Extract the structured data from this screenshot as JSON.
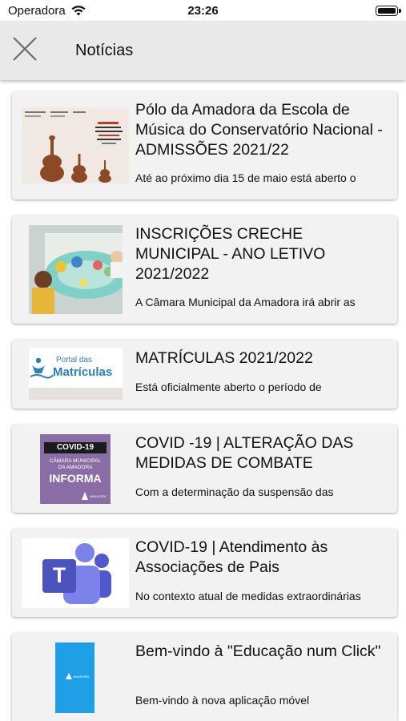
{
  "status_bar": {
    "carrier": "Operadora",
    "time": "23:26"
  },
  "nav": {
    "title": "Notícias",
    "close_icon": "close-icon"
  },
  "news": [
    {
      "title": "Pólo da Amadora da Escola de Música do Conservatório Nacional - ADMISSÕES 2021/22",
      "snippet": "Até ao próximo dia 15 de maio está aberto o",
      "thumb": "conservatory-poster-thumbnail"
    },
    {
      "title": "INSCRIÇÕES CRECHE MUNICIPAL - ANO LETIVO 2021/2022",
      "snippet": "A Câmara Municipal da Amadora irá abrir as",
      "thumb": "children-playing-photo"
    },
    {
      "title": "MATRÍCULAS 2021/2022",
      "snippet": "Está oficialmente aberto o período de",
      "thumb": "portal-matriculas-logo",
      "thumb_text_small": "Portal das",
      "thumb_text_big": "Matrículas"
    },
    {
      "title": "COVID -19 | ALTERAÇÃO DAS MEDIDAS DE COMBATE",
      "snippet": "Com a determinação da suspensão das",
      "thumb": "covid-informa-poster",
      "thumb_badge": "COVID-19",
      "thumb_line1": "CÂMARA MUNICIPAL",
      "thumb_line2": "DA AMADORA",
      "thumb_big": "INFORMA",
      "thumb_brand": "AMADORA"
    },
    {
      "title": "COVID-19 | Atendimento às Associações de Pais",
      "snippet": "No contexto atual de medidas extraordinárias",
      "thumb": "microsoft-teams-logo",
      "thumb_letter": "T"
    },
    {
      "title": "Bem-vindo à \"Educação num Click\"",
      "snippet": "Bem-vindo à nova aplicação móvel",
      "thumb": "app-phone-screen",
      "thumb_brand": "AMADORA"
    }
  ],
  "colors": {
    "nav_background": "#e9e9e9",
    "card_background": "#f2f2f2",
    "covid_purple": "#8a6da4",
    "teams_purple": "#5059c9",
    "app_blue": "#1e9fe6"
  }
}
